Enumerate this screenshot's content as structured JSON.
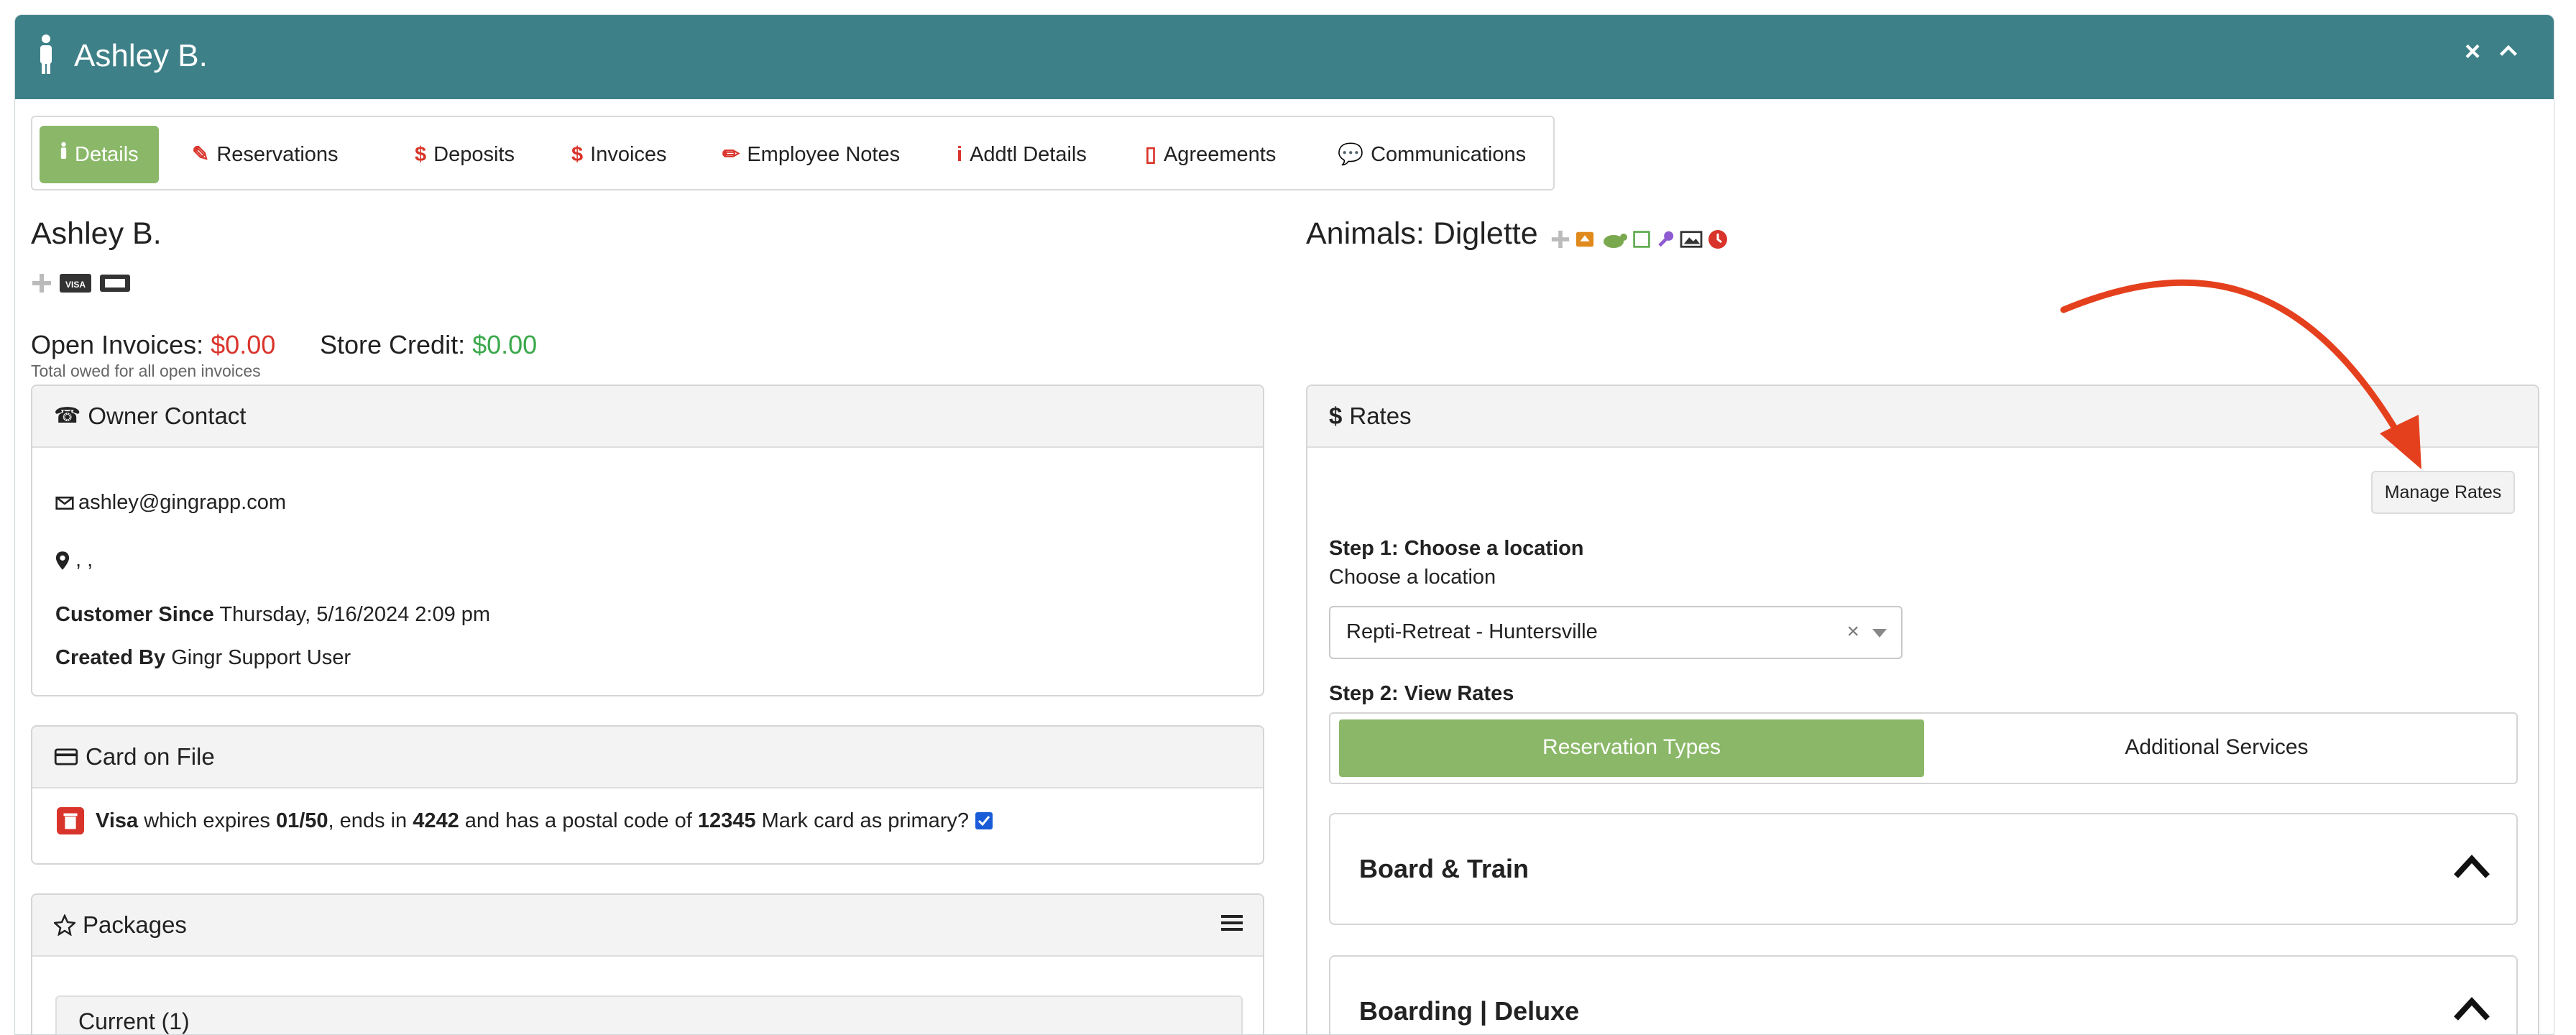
{
  "header": {
    "title": "Ashley B."
  },
  "tabs": [
    {
      "label": "Details",
      "icon": "person-icon",
      "active": true
    },
    {
      "label": "Reservations",
      "icon": "edit-icon"
    },
    {
      "label": "Deposits",
      "icon": "dollar-icon"
    },
    {
      "label": "Invoices",
      "icon": "dollar-icon"
    },
    {
      "label": "Employee Notes",
      "icon": "pencil-icon"
    },
    {
      "label": "Addtl Details",
      "icon": "info-icon"
    },
    {
      "label": "Agreements",
      "icon": "clipboard-icon"
    },
    {
      "label": "Communications",
      "icon": "chat-icon"
    }
  ],
  "owner": {
    "name": "Ashley B.",
    "open_invoices_label": "Open Invoices:",
    "open_invoices_value": "$0.00",
    "open_invoices_note": "Total owed for all open invoices",
    "store_credit_label": "Store Credit:",
    "store_credit_value": "$0.00"
  },
  "animals": {
    "label": "Animals: Diglette"
  },
  "owner_contact": {
    "title": "Owner Contact",
    "email": "ashley@gingrapp.com",
    "address": ", ,",
    "customer_since_label": "Customer Since",
    "customer_since_value": "Thursday, 5/16/2024 2:09 pm",
    "created_by_label": "Created By",
    "created_by_value": "Gingr Support User"
  },
  "card_on_file": {
    "title": "Card on File",
    "brand": "Visa",
    "text1": " which expires ",
    "expires": "01/50",
    "text2": ", ends in ",
    "last4": "4242",
    "text3": " and has a postal code of ",
    "postal": "12345",
    "primary_label": " Mark card as primary?"
  },
  "packages": {
    "title": "Packages",
    "current_label": "Current (1)"
  },
  "rates": {
    "title": "Rates",
    "manage_button": "Manage Rates",
    "step1": "Step 1: Choose a location",
    "step1_sub": "Choose a location",
    "location_value": "Repti-Retreat - Huntersville",
    "step2": "Step 2: View Rates",
    "seg_reservation": "Reservation Types",
    "seg_additional": "Additional Services",
    "accordions": [
      "Board & Train",
      "Boarding | Deluxe"
    ]
  },
  "colors": {
    "header_teal": "#3d8088",
    "active_green": "#8ab868",
    "tab_icon_red": "#d9342b",
    "invoice_red": "#d9342b",
    "credit_green": "#3aa84a",
    "arrow_red": "#e5401d"
  }
}
